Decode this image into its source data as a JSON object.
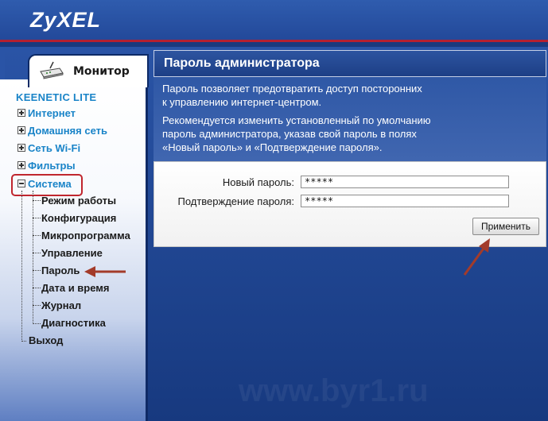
{
  "app": {
    "logo": "ZyXEL"
  },
  "tab": {
    "label": "Монитор"
  },
  "sidebar": {
    "brand": "KEENETIC LITE",
    "items": [
      {
        "label": "Интернет"
      },
      {
        "label": "Домашняя сеть"
      },
      {
        "label": "Сеть Wi-Fi"
      },
      {
        "label": "Фильтры"
      },
      {
        "label": "Система"
      }
    ],
    "sub_items": [
      {
        "label": "Режим работы"
      },
      {
        "label": "Конфигурация"
      },
      {
        "label": "Микропрограмма"
      },
      {
        "label": "Управление"
      },
      {
        "label": "Пароль"
      },
      {
        "label": "Дата и время"
      },
      {
        "label": "Журнал"
      },
      {
        "label": "Диагностика"
      }
    ],
    "exit": {
      "label": "Выход"
    }
  },
  "panel": {
    "title": "Пароль администратора",
    "desc_lines": [
      "Пароль позволяет предотвратить доступ посторонних",
      "к управлению интернет-центром.",
      "Рекомендуется изменить установленный по умолчанию",
      "пароль администратора, указав свой пароль в полях",
      "«Новый пароль» и «Подтверждение пароля»."
    ],
    "form": {
      "new_password": {
        "label": "Новый пароль:",
        "value": "*****"
      },
      "confirm_password": {
        "label": "Подтверждение пароля:",
        "value": "*****"
      },
      "apply_label": "Применить"
    }
  },
  "colors": {
    "accent_red": "#c0262e",
    "nav_blue": "#1a84c8",
    "header_blue": "#23499a"
  }
}
